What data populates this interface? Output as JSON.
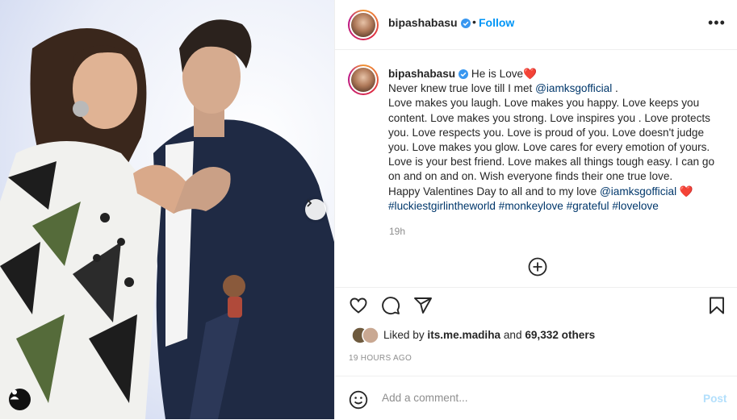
{
  "post": {
    "username": "bipashabasu",
    "follow_label": "Follow",
    "separator": "•",
    "more_label": "•••",
    "caption_parts": {
      "line1": " He is Love",
      "heart": "❤️",
      "line2_pre": "Never knew true love till I met ",
      "mention": "@iamksgofficial",
      "line2_post": " .",
      "body": "Love makes you laugh. Love makes you happy. Love keeps you content. Love makes you strong. Love inspires you . Love protects you. Love respects you. Love is proud of you. Love doesn't judge you. Love makes you glow. Love cares for every emotion of yours. Love is your best friend. Love makes all things tough easy. I can go on and on and on. Wish everyone finds their one true love.",
      "closing_pre": "Happy Valentines Day to all and to my love ",
      "closing_mention": "@iamksgofficial",
      "hashtags": [
        "#luckiestgirlintheworld",
        "#monkeylove",
        "#grateful",
        "#lovelove"
      ]
    },
    "time_ago_short": "19h",
    "likes": {
      "prefix": "Liked by ",
      "user": "its.me.madiha",
      "middle": " and ",
      "count": "69,332 others"
    },
    "time_ago_long": "19 HOURS AGO",
    "comment": {
      "placeholder": "Add a comment...",
      "value": "",
      "post_label": "Post"
    }
  },
  "icons": {
    "verified": "verified-badge-icon",
    "like": "heart-icon",
    "comment": "comment-bubble-icon",
    "share": "paper-plane-icon",
    "save": "bookmark-icon",
    "emoji": "smiley-icon",
    "more_comments": "plus-circle-icon",
    "next": "chevron-right-icon",
    "tags": "user-tag-icon"
  },
  "colors": {
    "link": "#00376b",
    "follow": "#0095f6",
    "verified": "#3897f0",
    "muted": "#8e8e8e",
    "post_disabled": "#b2dffc"
  }
}
